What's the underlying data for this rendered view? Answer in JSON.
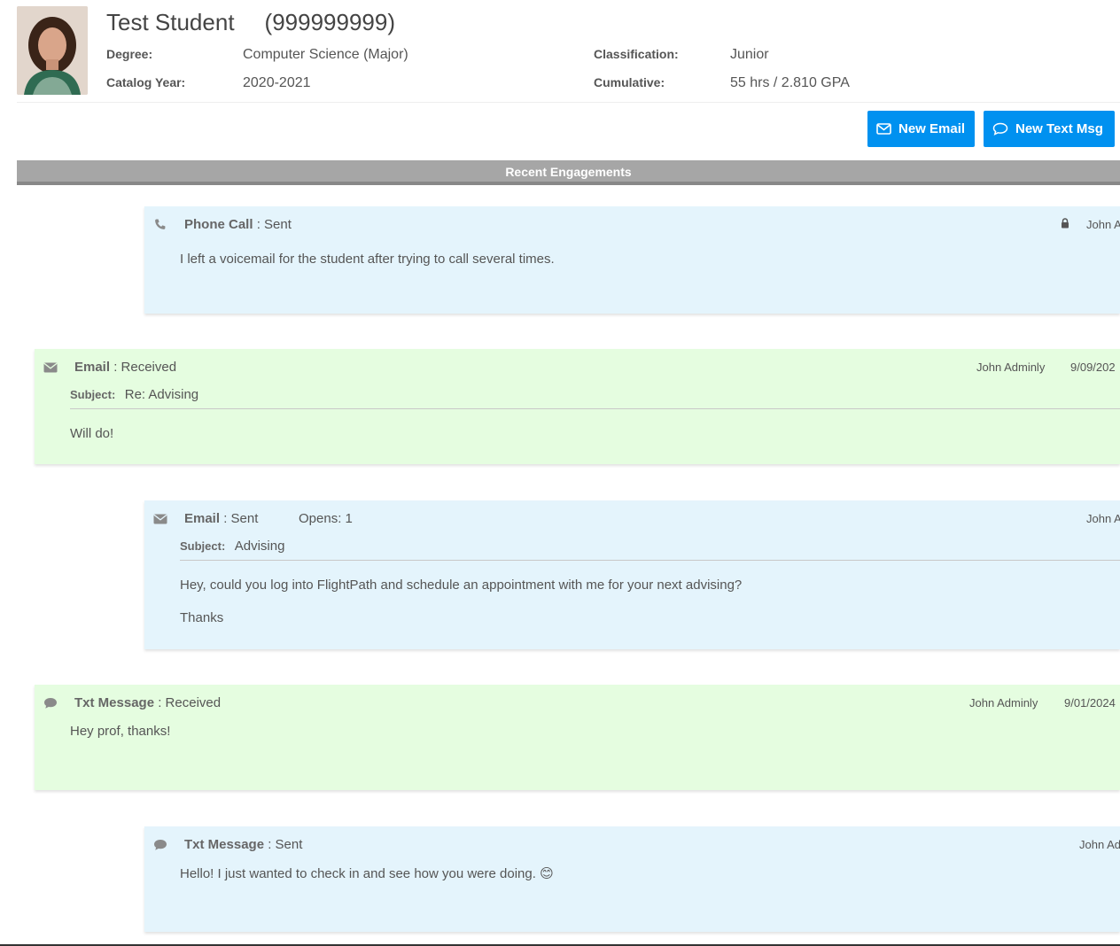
{
  "student": {
    "name": "Test Student",
    "id": "(999999999)",
    "degree_label": "Degree:",
    "degree": "Computer Science (Major)",
    "catalog_year_label": "Catalog Year:",
    "catalog_year": "2020-2021",
    "classification_label": "Classification:",
    "classification": "Junior",
    "cumulative_label": "Cumulative:",
    "cumulative": "55 hrs / 2.810 GPA"
  },
  "actions": {
    "new_email": "New Email",
    "new_text": "New Text Msg"
  },
  "section_title": "Recent Engagements",
  "engagements": [
    {
      "icon": "phone-icon",
      "type": "Phone Call",
      "status": ": Sent",
      "author": "John A",
      "private": true,
      "body": "I left a voicemail for the student after trying to call several times."
    },
    {
      "icon": "envelope-icon",
      "type": "Email",
      "status": ": Received",
      "author": "John Adminly",
      "date": "9/09/202",
      "subject_label": "Subject:",
      "subject": "Re: Advising",
      "body": "Will do!"
    },
    {
      "icon": "envelope-icon",
      "type": "Email",
      "status": ": Sent",
      "opens": "Opens: 1",
      "author": "John A",
      "subject_label": "Subject:",
      "subject": "Advising",
      "body": "Hey, could you log into FlightPath and schedule an appointment with me for your next advising?",
      "body2": "Thanks"
    },
    {
      "icon": "comment-icon",
      "type": "Txt Message",
      "status": ": Received",
      "author": "John Adminly",
      "date": "9/01/2024",
      "body": "Hey prof, thanks!"
    },
    {
      "icon": "comment-icon",
      "type": "Txt Message",
      "status": ": Sent",
      "author": "John Ad",
      "body": "Hello! I just wanted to check in and see how you were doing.",
      "emoji": "😊"
    }
  ],
  "colors": {
    "button": "#0091f0",
    "sent_card": "#e4f4fc",
    "received_card": "#e5fde0",
    "section_bar": "#a6a6a6"
  }
}
